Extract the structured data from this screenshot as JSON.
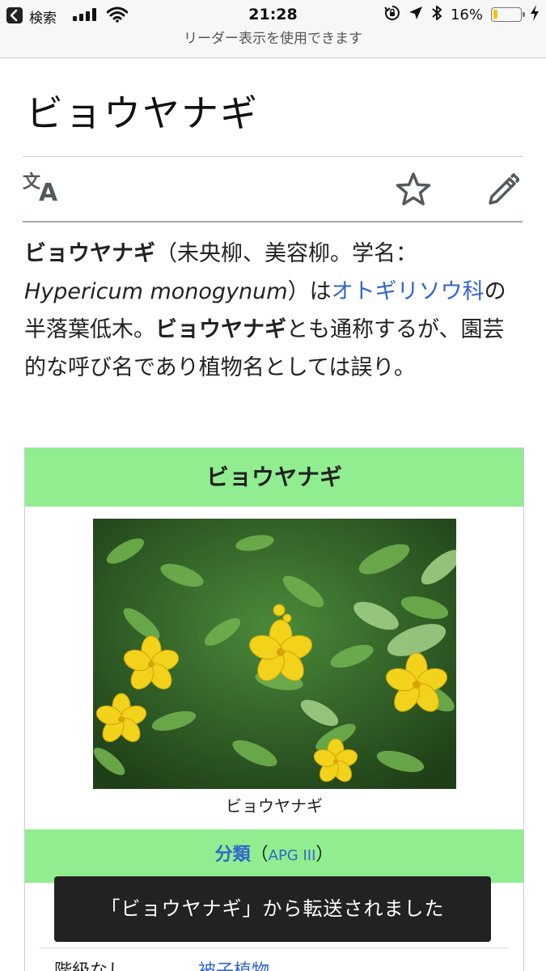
{
  "status_bar": {
    "back_label": "検索",
    "time": "21:28",
    "battery_percent": "16%",
    "battery_level": 0.16,
    "battery_color": "#f5c400"
  },
  "reader_banner": "リーダー表示を使用できます",
  "article": {
    "title": "ビョウヤナギ",
    "lead": {
      "name": "ビョウヤナギ",
      "p1": "（未央柳、美容柳。学名：",
      "scientific": "Hypericum monogynum",
      "p2": "）は",
      "family_link": "オトギリソウ科",
      "p3": "の半落葉低木。",
      "name2": "ビョウヤナギ",
      "p4": "とも通称するが、園芸的な呼び名であり植物名としては誤り。"
    }
  },
  "toolbar": {
    "icons": [
      "translate-icon",
      "star-icon",
      "pencil-icon"
    ]
  },
  "infobox": {
    "title": "ビョウヤナギ",
    "caption": "ビョウヤナギ",
    "header_color": "#90ee90",
    "classification_label": "分類",
    "classification_paren_open": "（",
    "classification_system": "APG III",
    "classification_paren_close": "）",
    "row_label": "階級なし",
    "row_value": "被子植物"
  },
  "toast": "「ビョウヤナギ」から転送されました",
  "colors": {
    "link": "#3366cc",
    "toast_bg": "#222222"
  }
}
